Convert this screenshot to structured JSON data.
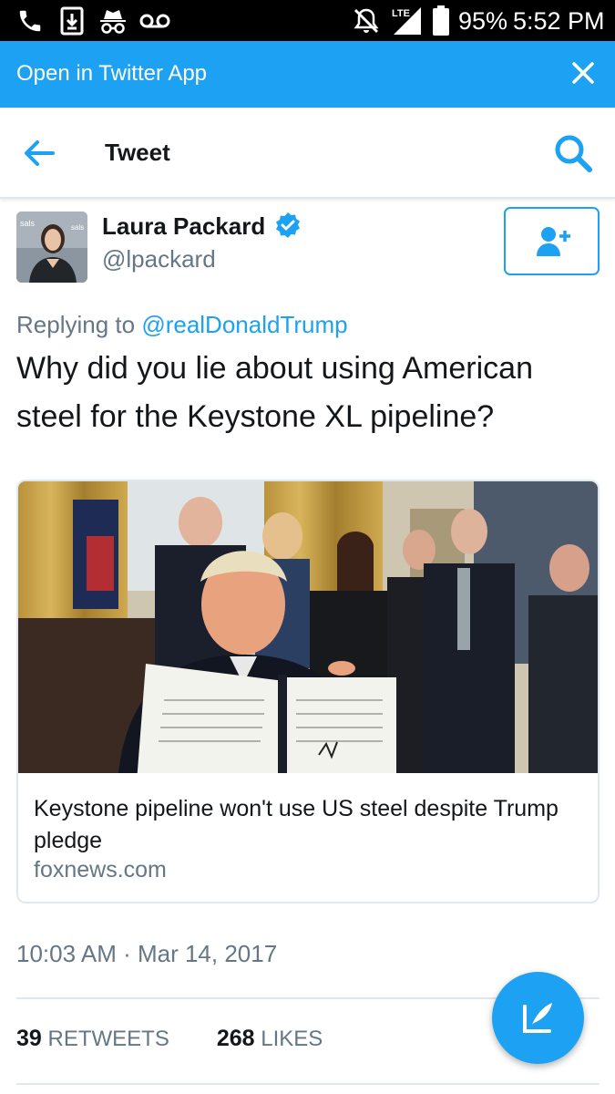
{
  "status_bar": {
    "battery": "95%",
    "time": "5:52 PM",
    "network": "LTE"
  },
  "banner": {
    "label": "Open in Twitter App"
  },
  "header": {
    "title": "Tweet"
  },
  "author": {
    "name": "Laura Packard",
    "handle": "@lpackard"
  },
  "tweet": {
    "replying_to_prefix": "Replying to",
    "replying_to_handle": "@realDonaldTrump",
    "text": "Why did you lie about using American steel for the Keystone XL pipeline?",
    "timestamp": "10:03 AM · Mar 14, 2017"
  },
  "card": {
    "title": "Keystone pipeline won't use US steel despite Trump pledge",
    "domain": "foxnews.com"
  },
  "stats": {
    "retweets_count": "39",
    "retweets_label": "RETWEETS",
    "likes_count": "268",
    "likes_label": "LIKES"
  },
  "colors": {
    "accent": "#1da1f2",
    "text_primary": "#14171a",
    "text_secondary": "#657786",
    "border": "#e1e8ed"
  },
  "icons": [
    "phone-icon",
    "download-icon",
    "incognito-icon",
    "voicemail-icon",
    "mute-icon",
    "signal-icon",
    "battery-icon",
    "close-icon",
    "back-arrow-icon",
    "search-icon",
    "verified-icon",
    "add-user-icon",
    "compose-icon"
  ]
}
